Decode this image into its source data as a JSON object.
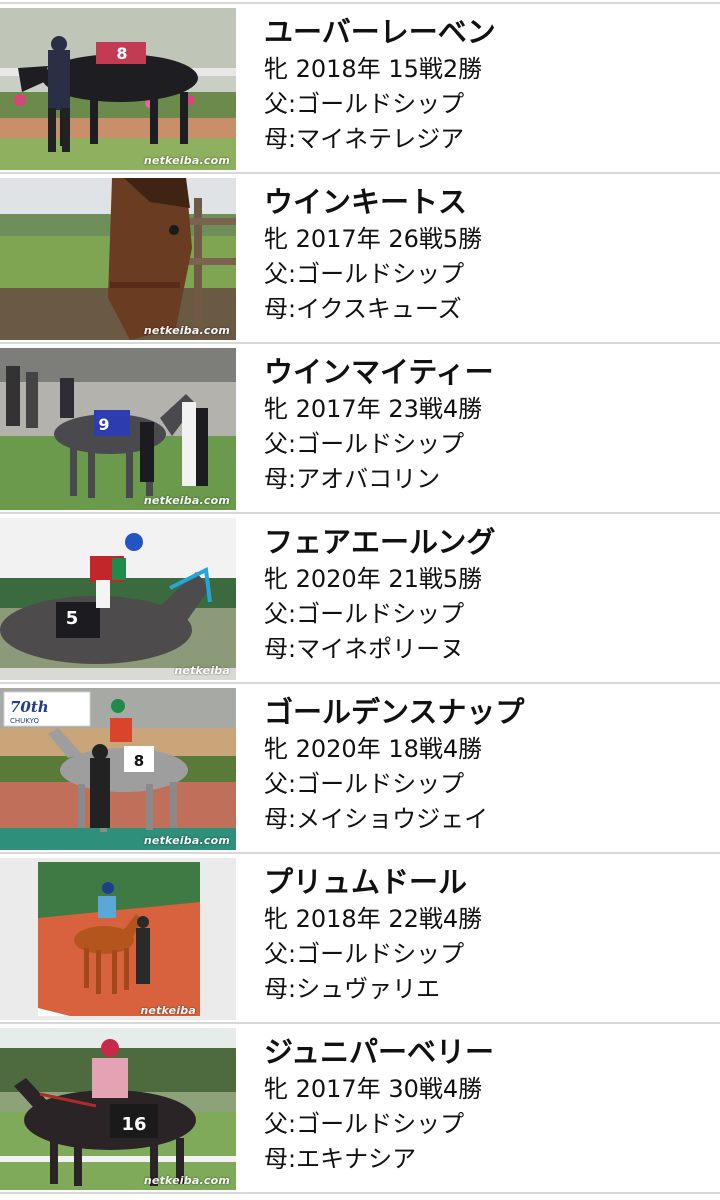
{
  "horses": [
    {
      "name": "ユーバーレーベン",
      "record": "牝 2018年  15戦2勝",
      "sire": "父:ゴールドシップ",
      "dam": "母:マイネテレジア",
      "watermark": "netkeiba.com"
    },
    {
      "name": "ウインキートス",
      "record": "牝 2017年  26戦5勝",
      "sire": "父:ゴールドシップ",
      "dam": "母:イクスキューズ",
      "watermark": "netkeiba.com"
    },
    {
      "name": "ウインマイティー",
      "record": "牝 2017年  23戦4勝",
      "sire": "父:ゴールドシップ",
      "dam": "母:アオバコリン",
      "watermark": "netkeiba.com"
    },
    {
      "name": "フェアエールング",
      "record": "牝 2020年  21戦5勝",
      "sire": "父:ゴールドシップ",
      "dam": "母:マイネポリーヌ",
      "watermark": "netkeiba"
    },
    {
      "name": "ゴールデンスナップ",
      "record": "牝 2020年  18戦4勝",
      "sire": "父:ゴールドシップ",
      "dam": "母:メイショウジェイ",
      "watermark": "netkeiba.com"
    },
    {
      "name": "プリュムドール",
      "record": "牝 2018年  22戦4勝",
      "sire": "父:ゴールドシップ",
      "dam": "母:シュヴァリエ",
      "watermark": "netkeiba"
    },
    {
      "name": "ジュニパーベリー",
      "record": "牝 2017年  30戦4勝",
      "sire": "父:ゴールドシップ",
      "dam": "母:エキナシア",
      "watermark": "netkeiba.com"
    }
  ],
  "photo_labels": {
    "row1_cloth": "8",
    "row3_cloth": "9",
    "row4_cloth": "5",
    "row5_banner": "70th",
    "row5_banner_sub": "CHUKYO",
    "row5_cloth": "8",
    "row7_cloth": "16"
  }
}
